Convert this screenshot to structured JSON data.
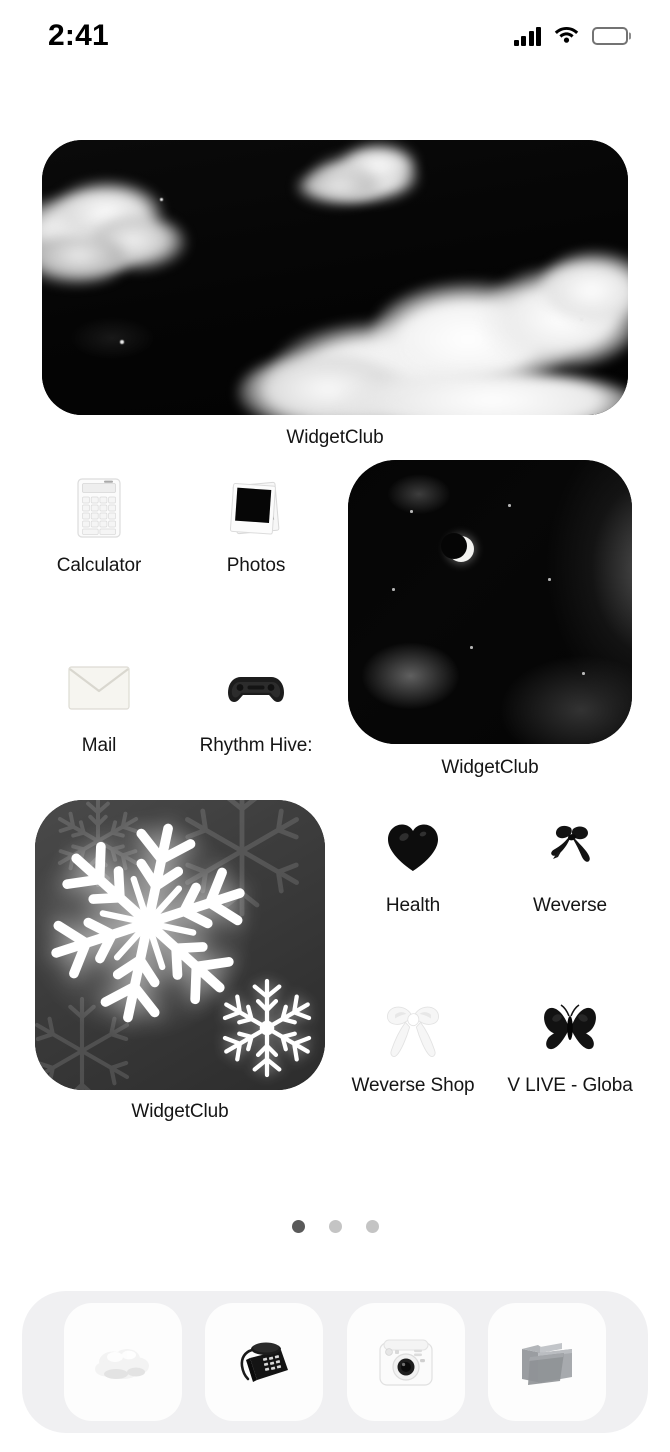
{
  "status_bar": {
    "time": "2:41",
    "cellular_icon": "signal-bars-icon",
    "wifi_icon": "wifi-icon",
    "battery_icon": "battery-full-icon"
  },
  "home_screen": {
    "widgets": [
      {
        "id": "clouds-wide",
        "label": "WidgetClub",
        "size": "4x2",
        "art": "dark-sky-with-white-clouds"
      },
      {
        "id": "moon",
        "label": "WidgetClub",
        "size": "2x2",
        "art": "night-sky-with-crescent-moon"
      },
      {
        "id": "snowflake",
        "label": "WidgetClub",
        "size": "2x2",
        "art": "white-snowflakes-on-gray"
      }
    ],
    "apps": [
      {
        "label": "Calculator",
        "icon": "calculator-icon"
      },
      {
        "label": "Photos",
        "icon": "polaroid-photo-icon"
      },
      {
        "label": "Mail",
        "icon": "envelope-icon"
      },
      {
        "label": "Rhythm Hive: ",
        "icon": "game-controller-icon",
        "truncated": true
      },
      {
        "label": "Health",
        "icon": "black-heart-icon"
      },
      {
        "label": "Weverse",
        "icon": "black-ribbon-bow-icon"
      },
      {
        "label": "Weverse Shop",
        "icon": "white-ribbon-bow-icon"
      },
      {
        "label": "V LIVE - Globa",
        "icon": "black-butterfly-icon",
        "truncated": true
      }
    ],
    "page_dots": {
      "count": 3,
      "active_index": 0
    },
    "dock": [
      {
        "icon": "cloud-icon",
        "name": "weather-app"
      },
      {
        "icon": "telephone-icon",
        "name": "phone-app"
      },
      {
        "icon": "instant-camera-icon",
        "name": "camera-app"
      },
      {
        "icon": "file-folder-icon",
        "name": "files-app"
      }
    ]
  },
  "colors": {
    "background": "#ffffff",
    "label_text": "#151515",
    "dock_background": "#f0f0f2",
    "dock_tile": "#fdfdfd",
    "page_dot_active": "#5a5a5a",
    "page_dot_inactive": "#c4c4c4"
  }
}
